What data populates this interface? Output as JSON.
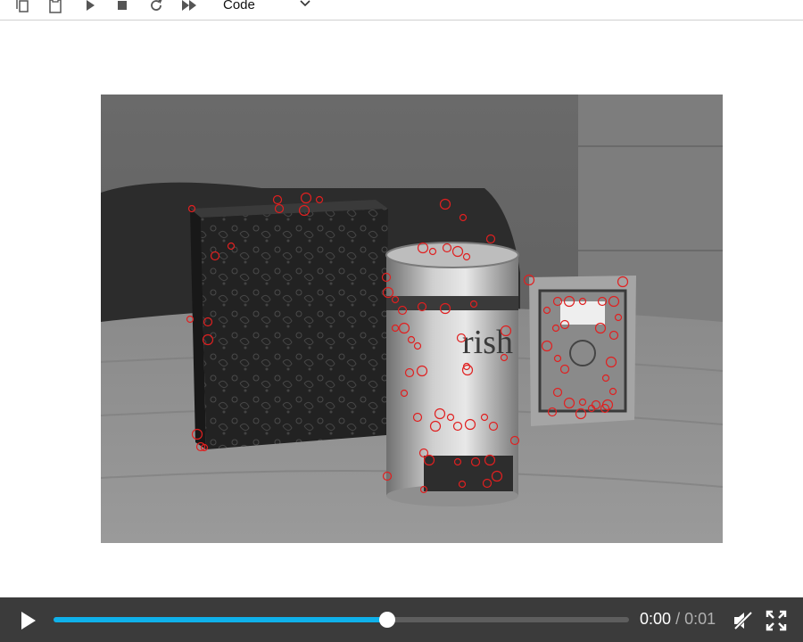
{
  "toolbar": {
    "cell_type": {
      "selected": "Code"
    },
    "buttons": [
      "copy-cells",
      "paste-cells",
      "run",
      "interrupt",
      "restart",
      "restart-run-all"
    ]
  },
  "video": {
    "current_time": "0:00",
    "separator": "/",
    "duration": "0:01",
    "progress_fraction": 0.58,
    "accent_color": "#0fb1ea",
    "control_bar_color": "#3b3b3b",
    "muted": true,
    "frame_description_colors": {
      "keypoint_marker": "#e02020"
    }
  }
}
